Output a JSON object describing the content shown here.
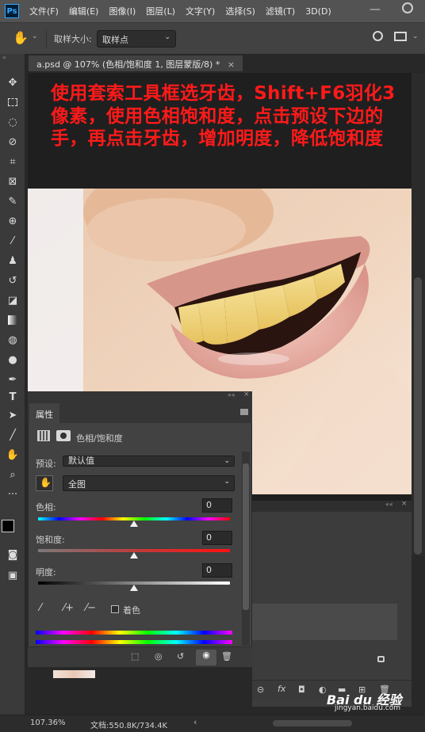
{
  "menu": {
    "logo": "Ps",
    "items": [
      "文件(F)",
      "编辑(E)",
      "图像(I)",
      "图层(L)",
      "文字(Y)",
      "选择(S)",
      "滤镜(T)",
      "3D(D)"
    ]
  },
  "options": {
    "sample_size_label": "取样大小:",
    "sample_size_value": "取样点"
  },
  "document": {
    "tab_title": "a.psd @ 107% (色相/饱和度 1, 图层蒙版/8) *",
    "caption": "使用套索工具框选牙齿，Shift+F6羽化3像素，使用色相饱和度，点击预设下边的手，再点击牙齿，增加明度，降低饱和度"
  },
  "properties": {
    "tab": "属性",
    "adjustment_name": "色相/饱和度",
    "preset_label": "预设:",
    "preset_value": "默认值",
    "channel_value": "全图",
    "hue_label": "色相:",
    "hue_value": "0",
    "saturation_label": "饱和度:",
    "saturation_value": "0",
    "lightness_label": "明度:",
    "lightness_value": "0",
    "colorize_label": "着色"
  },
  "status": {
    "zoom": "107.36%",
    "doc_size": "文档:550.8K/734.4K"
  },
  "watermark": {
    "brand": "Bai du 经验",
    "url": "jingyan.baidu.com"
  },
  "colors": {
    "caption_red": "#ff1a1a",
    "accent_blue": "#31a8ff"
  }
}
